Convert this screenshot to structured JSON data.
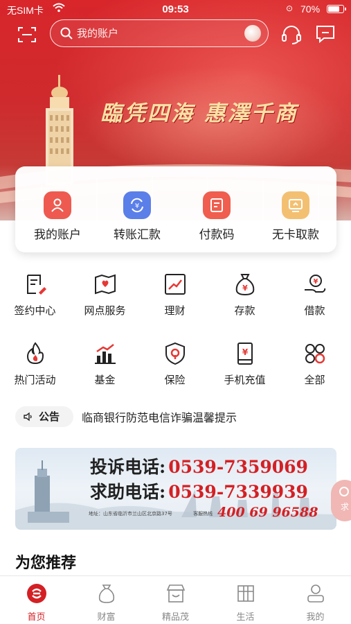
{
  "status_bar": {
    "carrier": "无SIM卡",
    "time": "09:53",
    "battery": "70%"
  },
  "search": {
    "placeholder": "我的账户"
  },
  "banner": {
    "slogan": "臨凭四海 惠澤千商"
  },
  "quick_actions": [
    {
      "label": "我的账户",
      "icon": "user-icon",
      "color": "#ee5a4f"
    },
    {
      "label": "转账汇款",
      "icon": "transfer-icon",
      "color": "#5b7fe8"
    },
    {
      "label": "付款码",
      "icon": "pay-code-icon",
      "color": "#ef5e4e"
    },
    {
      "label": "无卡取款",
      "icon": "cardless-withdraw-icon",
      "color": "#f3c072"
    }
  ],
  "menu_row1": [
    {
      "label": "签约中心",
      "icon": "sign-icon"
    },
    {
      "label": "网点服务",
      "icon": "branch-map-icon"
    },
    {
      "label": "理财",
      "icon": "wealth-chart-icon"
    },
    {
      "label": "存款",
      "icon": "deposit-bag-icon"
    },
    {
      "label": "借款",
      "icon": "loan-hand-icon"
    }
  ],
  "menu_row2": [
    {
      "label": "热门活动",
      "icon": "flame-icon"
    },
    {
      "label": "基金",
      "icon": "fund-bars-icon"
    },
    {
      "label": "保险",
      "icon": "shield-icon"
    },
    {
      "label": "手机充值",
      "icon": "phone-recharge-icon"
    },
    {
      "label": "全部",
      "icon": "all-apps-icon"
    }
  ],
  "notice": {
    "tag": "公告",
    "text": "临商银行防范电信诈骗温馨提示"
  },
  "hotline": {
    "complaint_label": "投诉电话:",
    "complaint_number": "0539-7359069",
    "help_label": "求助电话:",
    "help_number": "0539-7339939",
    "address": "地址：山东省临沂市兰山区北京路37号",
    "service_label": "客服热线",
    "service_number": "400 69 96588"
  },
  "float_help": {
    "label": "求"
  },
  "section": {
    "recommend_title": "为您推荐"
  },
  "tabs": [
    {
      "label": "首页",
      "icon": "home-icon",
      "active": true
    },
    {
      "label": "财富",
      "icon": "money-bag-icon",
      "active": false
    },
    {
      "label": "精品茂",
      "icon": "store-icon",
      "active": false
    },
    {
      "label": "生活",
      "icon": "gift-box-icon",
      "active": false
    },
    {
      "label": "我的",
      "icon": "profile-icon",
      "active": false
    }
  ],
  "colors": {
    "brand_red": "#d42024",
    "tab_inactive": "#888888"
  }
}
